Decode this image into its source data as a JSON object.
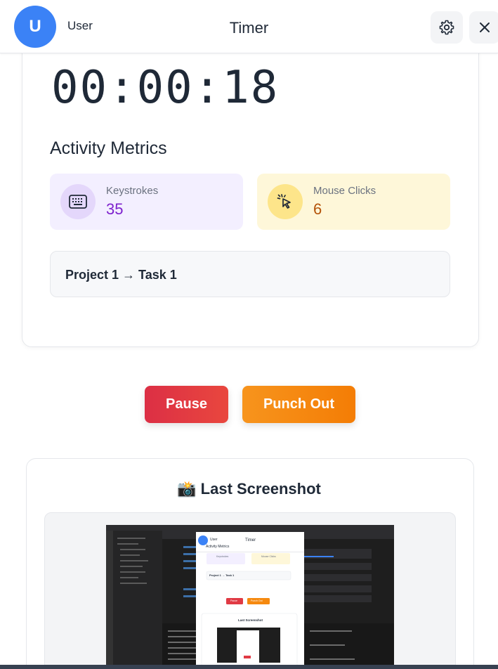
{
  "header": {
    "avatar_initial": "U",
    "user_name": "User",
    "title": "Timer"
  },
  "timer": {
    "elapsed": "00:00:18"
  },
  "metrics": {
    "heading": "Activity Metrics",
    "keystrokes": {
      "label": "Keystrokes",
      "value": "35"
    },
    "mouse_clicks": {
      "label": "Mouse Clicks",
      "value": "6"
    }
  },
  "task": {
    "label": "Project 1 → Task 1"
  },
  "actions": {
    "pause_label": "Pause",
    "punch_out_label": "Punch Out"
  },
  "screenshot": {
    "title": "📸 Last Screenshot",
    "thumbnail": {
      "mini_user": "User",
      "mini_title": "Timer",
      "mini_heading": "Activity Metrics",
      "mini_keystrokes": "Keystrokes",
      "mini_clicks": "Mouse Clicks",
      "mini_task": "Project 1 → Task 1",
      "mini_pause": "Pause",
      "mini_punch": "Punch Out",
      "mini_shot_title": "Last Screenshot"
    }
  },
  "colors": {
    "accent_blue": "#3b82f6",
    "pause_red": "#e03a44",
    "punch_orange": "#f5890f",
    "keys_purple": "#7e22ce",
    "clicks_amber": "#b45309"
  }
}
